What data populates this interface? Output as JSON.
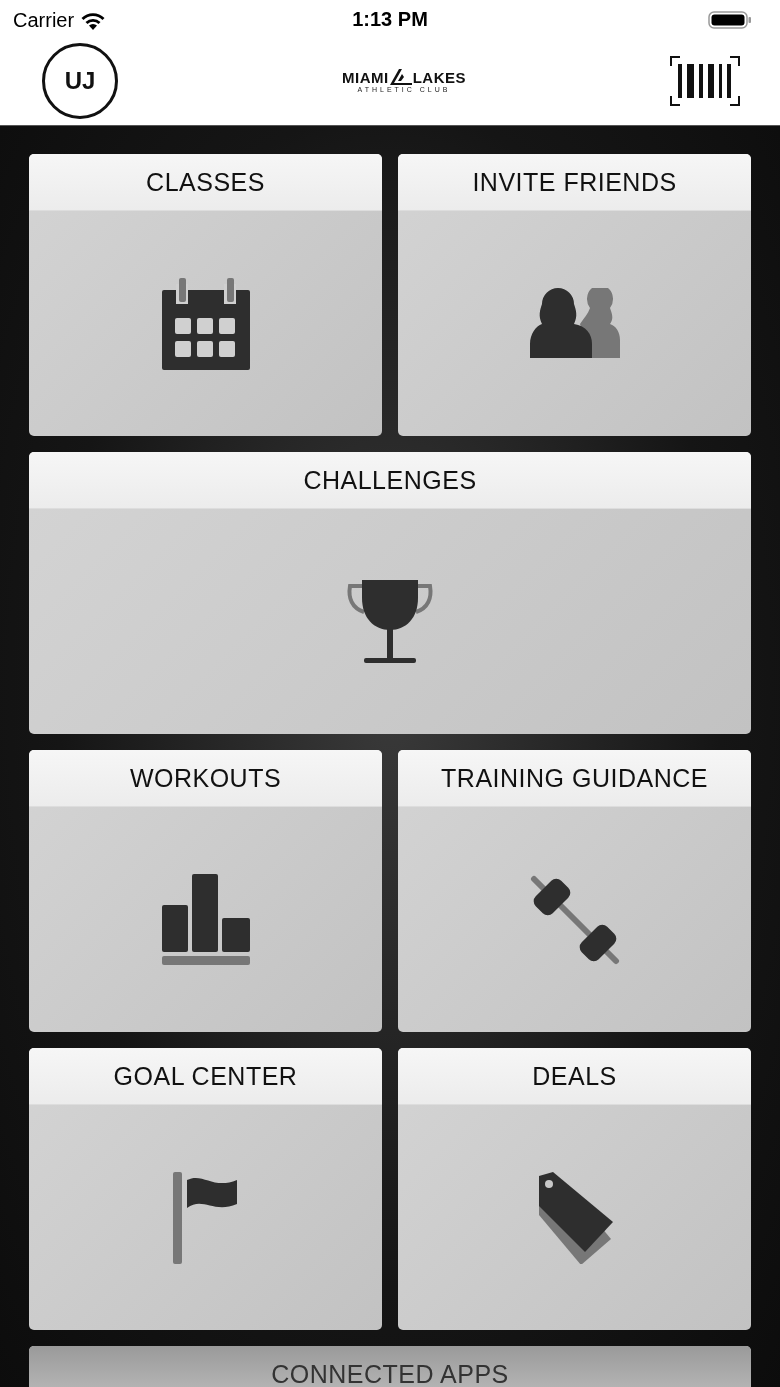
{
  "status_bar": {
    "carrier": "Carrier",
    "time": "1:13 PM"
  },
  "header": {
    "avatar_initials": "UJ",
    "logo": {
      "word_1": "MIAMI",
      "word_2": "LAKES",
      "tagline": "ATHLETIC CLUB"
    }
  },
  "tiles": [
    {
      "label": "CLASSES",
      "kind": "half"
    },
    {
      "label": "INVITE FRIENDS",
      "kind": "half"
    },
    {
      "label": "CHALLENGES",
      "kind": "full"
    },
    {
      "label": "WORKOUTS",
      "kind": "half"
    },
    {
      "label": "TRAINING GUIDANCE",
      "kind": "half"
    },
    {
      "label": "GOAL CENTER",
      "kind": "half"
    },
    {
      "label": "DEALS",
      "kind": "half"
    },
    {
      "label": "CONNECTED APPS",
      "kind": "full"
    }
  ]
}
